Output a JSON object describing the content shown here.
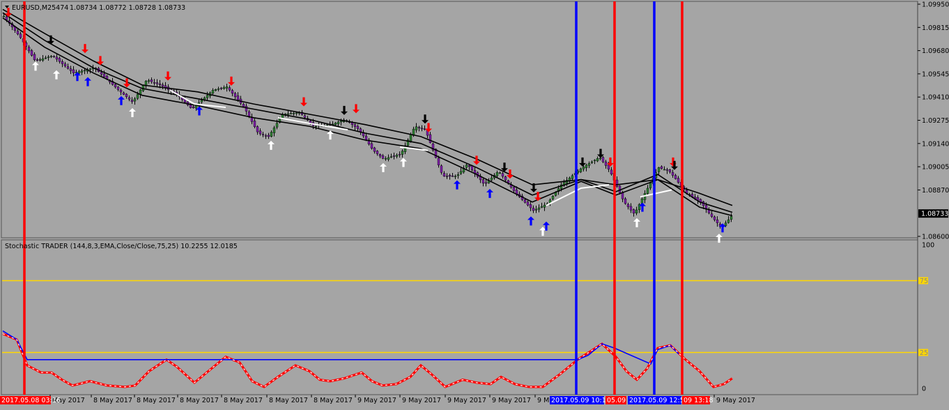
{
  "window": {
    "main_title": "EURUSD,M25474",
    "ohlc": "1.08734 1.08772 1.08728 1.08733",
    "sub_title": "Stochastic TRADER (144,8,3,EMA,Close/Close,75,25) 10.2255 12.0185"
  },
  "price_axis": {
    "ticks": [
      "1.09950",
      "1.09815",
      "1.09680",
      "1.09545",
      "1.09410",
      "1.09275",
      "1.09140",
      "1.09005",
      "1.08870",
      "1.08600"
    ],
    "current_price": "1.08733"
  },
  "stoch_axis": {
    "ticks": [
      "100",
      "0"
    ],
    "levels": [
      "75",
      "25"
    ]
  },
  "time_axis": {
    "labels": [
      "May 2017",
      "8 May 2017",
      "8 May 2017",
      "8 May 2017",
      "8 May 2017",
      "8 May 2017",
      "8 May 2017",
      "9 May 2017",
      "9 May 2017",
      "9 May 2017",
      "9 May 2017",
      "9 M",
      "9 May 2017"
    ],
    "tags": [
      {
        "text": "2017.05.08 03:16",
        "color": "#ff0000"
      },
      {
        "text": "2017.05.09 10:11",
        "color": "#0000ff"
      },
      {
        "text": "05.09",
        "color": "#ff0000"
      },
      {
        "text": "2017.05.09 12:59",
        "color": "#0000ff"
      },
      {
        "text": "09 13:18",
        "color": "#ff0000"
      }
    ]
  },
  "colors": {
    "background": "#a5a5a5",
    "bull_candle": "#2e7d32",
    "bear_candle": "#7b1fa2",
    "ma": "#000000",
    "white_line": "#ffffff",
    "level_line": "#ffd700",
    "red_vline": "#ff0000",
    "blue_vline": "#0000ff",
    "stoch_main": "#ff0000",
    "stoch_signal": "#0000ff"
  },
  "chart_data": [
    {
      "type": "candlestick",
      "title": "EURUSD,M25474",
      "ylim": [
        1.086,
        1.0995
      ],
      "price_path": [
        [
          0,
          1.0988
        ],
        [
          25,
          1.0975
        ],
        [
          45,
          1.0962
        ],
        [
          70,
          1.0965
        ],
        [
          100,
          1.0955
        ],
        [
          130,
          1.0958
        ],
        [
          165,
          1.0945
        ],
        [
          185,
          1.0938
        ],
        [
          205,
          1.0951
        ],
        [
          225,
          1.0948
        ],
        [
          250,
          1.0942
        ],
        [
          270,
          1.0934
        ],
        [
          300,
          1.0945
        ],
        [
          320,
          1.0947
        ],
        [
          345,
          1.0935
        ],
        [
          365,
          1.092
        ],
        [
          380,
          1.0918
        ],
        [
          400,
          1.0931
        ],
        [
          425,
          1.0932
        ],
        [
          445,
          1.0924
        ],
        [
          470,
          1.0925
        ],
        [
          490,
          1.0928
        ],
        [
          510,
          1.0922
        ],
        [
          530,
          1.091
        ],
        [
          545,
          1.0905
        ],
        [
          570,
          1.0908
        ],
        [
          590,
          1.0924
        ],
        [
          605,
          1.0922
        ],
        [
          630,
          1.0895
        ],
        [
          650,
          1.0895
        ],
        [
          665,
          1.0902
        ],
        [
          690,
          1.089
        ],
        [
          710,
          1.0898
        ],
        [
          735,
          1.0885
        ],
        [
          760,
          1.0875
        ],
        [
          780,
          1.0879
        ],
        [
          800,
          1.089
        ],
        [
          830,
          1.09
        ],
        [
          855,
          1.0906
        ],
        [
          870,
          1.0898
        ],
        [
          890,
          1.088
        ],
        [
          905,
          1.0873
        ],
        [
          920,
          1.0885
        ],
        [
          940,
          1.09
        ],
        [
          955,
          1.0898
        ],
        [
          965,
          1.0893
        ],
        [
          980,
          1.0885
        ],
        [
          1000,
          1.088
        ],
        [
          1015,
          1.0872
        ],
        [
          1030,
          1.0865
        ],
        [
          1047,
          1.0873
        ]
      ],
      "moving_averages": [
        {
          "path": [
            [
              0,
              1.0992
            ],
            [
              60,
              1.0978
            ],
            [
              130,
              1.0962
            ],
            [
              200,
              1.0948
            ],
            [
              280,
              1.0944
            ],
            [
              360,
              1.0937
            ],
            [
              440,
              1.0931
            ],
            [
              520,
              1.0925
            ],
            [
              600,
              1.0918
            ],
            [
              680,
              1.0905
            ],
            [
              760,
              1.089
            ],
            [
              830,
              1.0893
            ],
            [
              880,
              1.089
            ],
            [
              940,
              1.0893
            ],
            [
              1000,
              1.0885
            ],
            [
              1047,
              1.0878
            ]
          ]
        },
        {
          "path": [
            [
              0,
              1.099
            ],
            [
              60,
              1.0974
            ],
            [
              130,
              1.0958
            ],
            [
              200,
              1.0946
            ],
            [
              280,
              1.094
            ],
            [
              360,
              1.0934
            ],
            [
              440,
              1.0928
            ],
            [
              520,
              1.092
            ],
            [
              600,
              1.0914
            ],
            [
              680,
              1.09
            ],
            [
              760,
              1.0884
            ],
            [
              830,
              1.0893
            ],
            [
              880,
              1.0886
            ],
            [
              940,
              1.0896
            ],
            [
              1000,
              1.088
            ],
            [
              1047,
              1.0874
            ]
          ]
        },
        {
          "path": [
            [
              0,
              1.0987
            ],
            [
              60,
              1.097
            ],
            [
              130,
              1.0955
            ],
            [
              200,
              1.0942
            ],
            [
              280,
              1.0936
            ],
            [
              360,
              1.0929
            ],
            [
              440,
              1.0924
            ],
            [
              520,
              1.0916
            ],
            [
              600,
              1.0911
            ],
            [
              680,
              1.0896
            ],
            [
              760,
              1.088
            ],
            [
              830,
              1.0892
            ],
            [
              880,
              1.0884
            ],
            [
              940,
              1.0893
            ],
            [
              1000,
              1.0877
            ],
            [
              1047,
              1.0872
            ]
          ]
        }
      ],
      "white_line_segments": [
        [
          [
            240,
            1.0945
          ],
          [
            275,
            1.0937
          ],
          [
            320,
            1.0935
          ]
        ],
        [
          [
            395,
            1.0929
          ],
          [
            450,
            1.0925
          ],
          [
            495,
            1.0922
          ]
        ],
        [
          [
            570,
            1.0912
          ],
          [
            610,
            1.091
          ]
        ],
        [
          [
            780,
            1.0878
          ],
          [
            830,
            1.0888
          ],
          [
            870,
            1.089
          ]
        ],
        [
          [
            915,
            1.0883
          ],
          [
            960,
            1.0887
          ]
        ]
      ],
      "up_arrows": [
        {
          "x": 8,
          "p": 1.0988,
          "color": "#ff0000"
        },
        {
          "x": 69,
          "p": 1.0972,
          "color": "#000000"
        },
        {
          "x": 118,
          "p": 1.0967,
          "color": "#ff0000"
        },
        {
          "x": 140,
          "p": 1.096,
          "color": "#ff0000"
        },
        {
          "x": 178,
          "p": 1.0947,
          "color": "#ff0000"
        },
        {
          "x": 237,
          "p": 1.0951,
          "color": "#ff0000"
        },
        {
          "x": 328,
          "p": 1.0948,
          "color": "#ff0000"
        },
        {
          "x": 432,
          "p": 1.0936,
          "color": "#ff0000"
        },
        {
          "x": 507,
          "p": 1.0932,
          "color": "#ff0000"
        },
        {
          "x": 490,
          "p": 1.0931,
          "color": "#000000"
        },
        {
          "x": 606,
          "p": 1.0926,
          "color": "#000000"
        },
        {
          "x": 611,
          "p": 1.0921,
          "color": "#ff0000"
        },
        {
          "x": 680,
          "p": 1.0902,
          "color": "#ff0000"
        },
        {
          "x": 720,
          "p": 1.0898,
          "color": "#000000"
        },
        {
          "x": 728,
          "p": 1.0894,
          "color": "#ff0000"
        },
        {
          "x": 762,
          "p": 1.0886,
          "color": "#000000"
        },
        {
          "x": 768,
          "p": 1.0881,
          "color": "#ff0000"
        },
        {
          "x": 832,
          "p": 1.0901,
          "color": "#000000"
        },
        {
          "x": 858,
          "p": 1.0906,
          "color": "#000000"
        },
        {
          "x": 872,
          "p": 1.0901,
          "color": "#ff0000"
        },
        {
          "x": 962,
          "p": 1.0901,
          "color": "#ff0000"
        },
        {
          "x": 964,
          "p": 1.0899,
          "color": "#000000"
        }
      ],
      "down_arrows": [
        {
          "x": 47,
          "p": 1.0962,
          "color": "#ffffff"
        },
        {
          "x": 77,
          "p": 1.0957,
          "color": "#ffffff"
        },
        {
          "x": 107,
          "p": 1.0956,
          "color": "#0000ff"
        },
        {
          "x": 122,
          "p": 1.0953,
          "color": "#0000ff"
        },
        {
          "x": 170,
          "p": 1.0942,
          "color": "#0000ff"
        },
        {
          "x": 186,
          "p": 1.0935,
          "color": "#ffffff"
        },
        {
          "x": 282,
          "p": 1.0936,
          "color": "#0000ff"
        },
        {
          "x": 385,
          "p": 1.0916,
          "color": "#ffffff"
        },
        {
          "x": 470,
          "p": 1.0922,
          "color": "#ffffff"
        },
        {
          "x": 546,
          "p": 1.0903,
          "color": "#ffffff"
        },
        {
          "x": 575,
          "p": 1.0906,
          "color": "#ffffff"
        },
        {
          "x": 652,
          "p": 1.0893,
          "color": "#0000ff"
        },
        {
          "x": 699,
          "p": 1.0888,
          "color": "#0000ff"
        },
        {
          "x": 758,
          "p": 1.0872,
          "color": "#0000ff"
        },
        {
          "x": 775,
          "p": 1.0866,
          "color": "#ffffff"
        },
        {
          "x": 780,
          "p": 1.0869,
          "color": "#0000ff"
        },
        {
          "x": 910,
          "p": 1.0871,
          "color": "#ffffff"
        },
        {
          "x": 918,
          "p": 1.088,
          "color": "#0000ff"
        },
        {
          "x": 1028,
          "p": 1.0862,
          "color": "#ffffff"
        },
        {
          "x": 1033,
          "p": 1.0868,
          "color": "#0000ff"
        }
      ]
    },
    {
      "type": "line",
      "title": "Stochastic TRADER (144,8,3,EMA,Close/Close,75,25) 10.2255 12.0185",
      "ylim": [
        0,
        100
      ],
      "levels": [
        75,
        25
      ],
      "series": [
        {
          "values": [
            [
              0,
              38
            ],
            [
              20,
              34
            ],
            [
              35,
              16
            ],
            [
              55,
              11
            ],
            [
              70,
              11
            ],
            [
              85,
              6
            ],
            [
              100,
              2
            ],
            [
              125,
              5
            ],
            [
              150,
              2
            ],
            [
              175,
              1
            ],
            [
              190,
              2
            ],
            [
              210,
              12
            ],
            [
              235,
              20
            ],
            [
              250,
              15
            ],
            [
              275,
              4
            ],
            [
              295,
              12
            ],
            [
              320,
              22
            ],
            [
              340,
              18
            ],
            [
              358,
              5
            ],
            [
              375,
              1
            ],
            [
              395,
              8
            ],
            [
              420,
              16
            ],
            [
              440,
              12
            ],
            [
              455,
              6
            ],
            [
              470,
              5
            ],
            [
              490,
              7
            ],
            [
              515,
              11
            ],
            [
              530,
              5
            ],
            [
              545,
              2
            ],
            [
              565,
              3
            ],
            [
              585,
              8
            ],
            [
              600,
              16
            ],
            [
              615,
              10
            ],
            [
              635,
              1
            ],
            [
              660,
              6
            ],
            [
              680,
              4
            ],
            [
              700,
              3
            ],
            [
              715,
              8
            ],
            [
              735,
              3
            ],
            [
              755,
              1
            ],
            [
              775,
              1
            ],
            [
              800,
              10
            ],
            [
              825,
              20
            ],
            [
              860,
              31
            ],
            [
              880,
              22
            ],
            [
              895,
              12
            ],
            [
              910,
              6
            ],
            [
              925,
              14
            ],
            [
              940,
              28
            ],
            [
              958,
              30
            ],
            [
              980,
              20
            ],
            [
              1000,
              12
            ],
            [
              1020,
              1
            ],
            [
              1035,
              3
            ],
            [
              1047,
              7
            ]
          ]
        },
        {
          "values": [
            [
              0,
              40
            ],
            [
              20,
              34
            ],
            [
              35,
              20
            ],
            [
              825,
              20
            ],
            [
              840,
              23
            ],
            [
              860,
              31
            ],
            [
              878,
              28
            ],
            [
              930,
              17
            ],
            [
              940,
              27
            ],
            [
              958,
              30
            ],
            [
              970,
              24
            ]
          ]
        }
      ]
    }
  ]
}
